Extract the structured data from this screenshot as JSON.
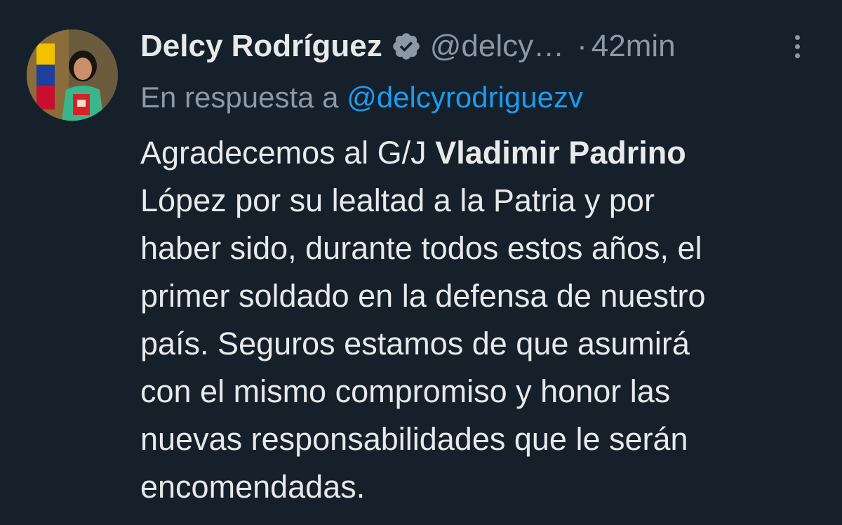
{
  "author": {
    "display_name": "Delcy Rodríguez",
    "handle": "@delcy…",
    "separator": "·",
    "time": "42min",
    "avatar_icon": "profile-photo-icon",
    "verified_icon": "verified-badge-icon"
  },
  "reply": {
    "prefix": "En respuesta a",
    "mention": "@delcyrodriguezv"
  },
  "body": {
    "lines": [
      {
        "pre": "Agradecemos al G/J ",
        "bold": "Vladimir Padrino"
      },
      "López por su lealtad a la Patria y por",
      "haber sido, durante todos estos años, el",
      "primer soldado en la defensa de nuestro",
      "país. Seguros estamos de que asumirá",
      "con el mismo compromiso y honor las",
      "nuevas responsabilidades que le serán",
      "encomendadas."
    ]
  },
  "colors": {
    "background": "#15202b",
    "text": "#e7e9ea",
    "muted": "#8b98a5",
    "link": "#1d9bf0"
  }
}
